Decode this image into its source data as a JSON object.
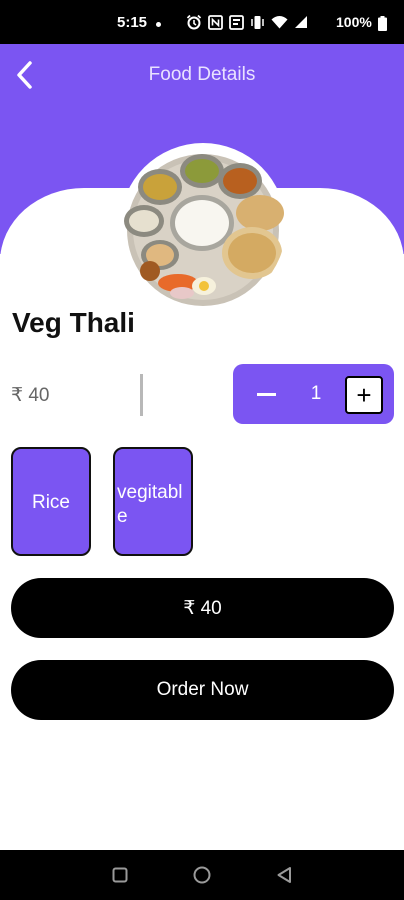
{
  "status_bar": {
    "time": "5:15",
    "battery": "100%"
  },
  "header": {
    "title": "Food Details"
  },
  "product": {
    "name": "Veg Thali",
    "price": "₹ 40"
  },
  "quantity": {
    "value": "1",
    "minus": "−",
    "plus": "+"
  },
  "options": [
    {
      "label": "Rice"
    },
    {
      "label": "vegitable"
    }
  ],
  "total": {
    "label": "₹ 40"
  },
  "order": {
    "label": "Order Now"
  },
  "icons": {
    "back": "chevron-left-icon",
    "status": [
      "alarm-icon",
      "nfc-icon",
      "message-icon",
      "vibrate-icon",
      "wifi-icon",
      "signal-icon",
      "battery-icon"
    ],
    "nav": [
      "recents-square-icon",
      "home-circle-icon",
      "back-triangle-icon"
    ]
  },
  "colors": {
    "accent": "#7b55f2",
    "button": "#000000",
    "background": "#ffffff"
  }
}
